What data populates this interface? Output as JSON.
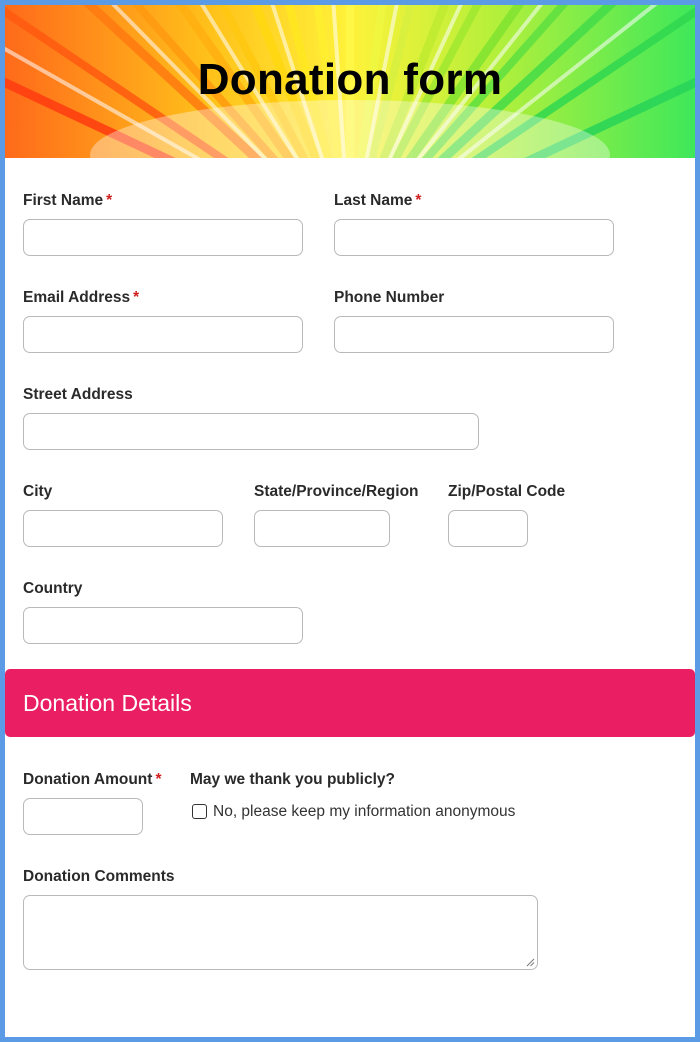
{
  "header": {
    "title": "Donation form"
  },
  "fields": {
    "first_name": {
      "label": "First Name",
      "required": "*"
    },
    "last_name": {
      "label": "Last Name",
      "required": "*"
    },
    "email": {
      "label": "Email Address",
      "required": "*"
    },
    "phone": {
      "label": "Phone Number"
    },
    "street": {
      "label": "Street Address"
    },
    "city": {
      "label": "City"
    },
    "state": {
      "label": "State/Province/Region"
    },
    "zip": {
      "label": "Zip/Postal Code"
    },
    "country": {
      "label": "Country"
    }
  },
  "donation_section": {
    "title": "Donation Details",
    "amount": {
      "label": "Donation Amount",
      "required": "*"
    },
    "thank_publicly": {
      "label": "May we thank you publicly?",
      "option": "No, please keep my information anonymous",
      "checked": false
    },
    "comments": {
      "label": "Donation Comments"
    }
  },
  "colors": {
    "accent": "#e91e63",
    "required": "#d0201f",
    "frame_border": "#5b9be6"
  }
}
